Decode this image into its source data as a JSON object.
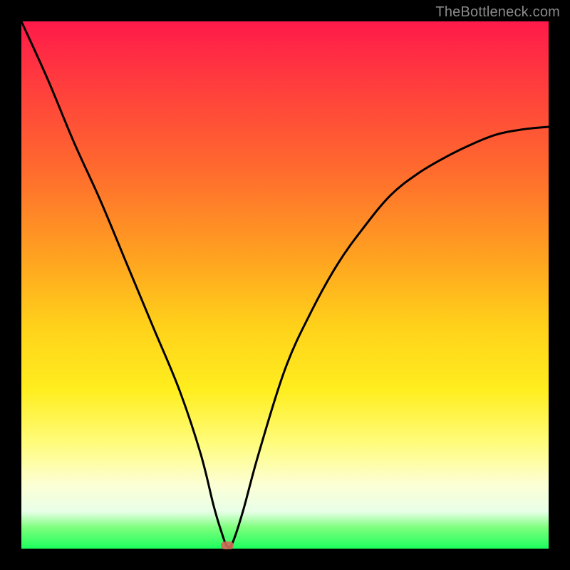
{
  "watermark": "TheBottleneck.com",
  "colors": {
    "frame": "#000000",
    "curve": "#000000",
    "marker": "#d46a5a",
    "gradient_stops": [
      "#ff1a4a",
      "#ff3d3d",
      "#ff6a2e",
      "#ffa320",
      "#ffd21a",
      "#ffee1f",
      "#fffc7c",
      "#fcffd6",
      "#e8ffe8",
      "#7dff7d",
      "#1cff5e"
    ]
  },
  "chart_data": {
    "type": "line",
    "title": "",
    "xlabel": "",
    "ylabel": "",
    "xlim": [
      0,
      100
    ],
    "ylim": [
      0,
      100
    ],
    "series": [
      {
        "name": "curve",
        "x": [
          0,
          5,
          10,
          15,
          20,
          25,
          30,
          34,
          36.5,
          38,
          39,
          40,
          42,
          45,
          50,
          55,
          60,
          65,
          70,
          75,
          80,
          85,
          90,
          95,
          100
        ],
        "values": [
          100,
          89,
          77,
          66,
          54,
          42,
          30,
          18,
          8,
          3,
          0.5,
          1,
          7,
          18,
          34,
          45,
          54,
          61,
          67,
          71,
          74,
          76.5,
          78.5,
          79.5,
          80
        ]
      }
    ],
    "minimum_point": {
      "x": 39,
      "y": 0.5
    },
    "grid": false,
    "legend": false
  }
}
